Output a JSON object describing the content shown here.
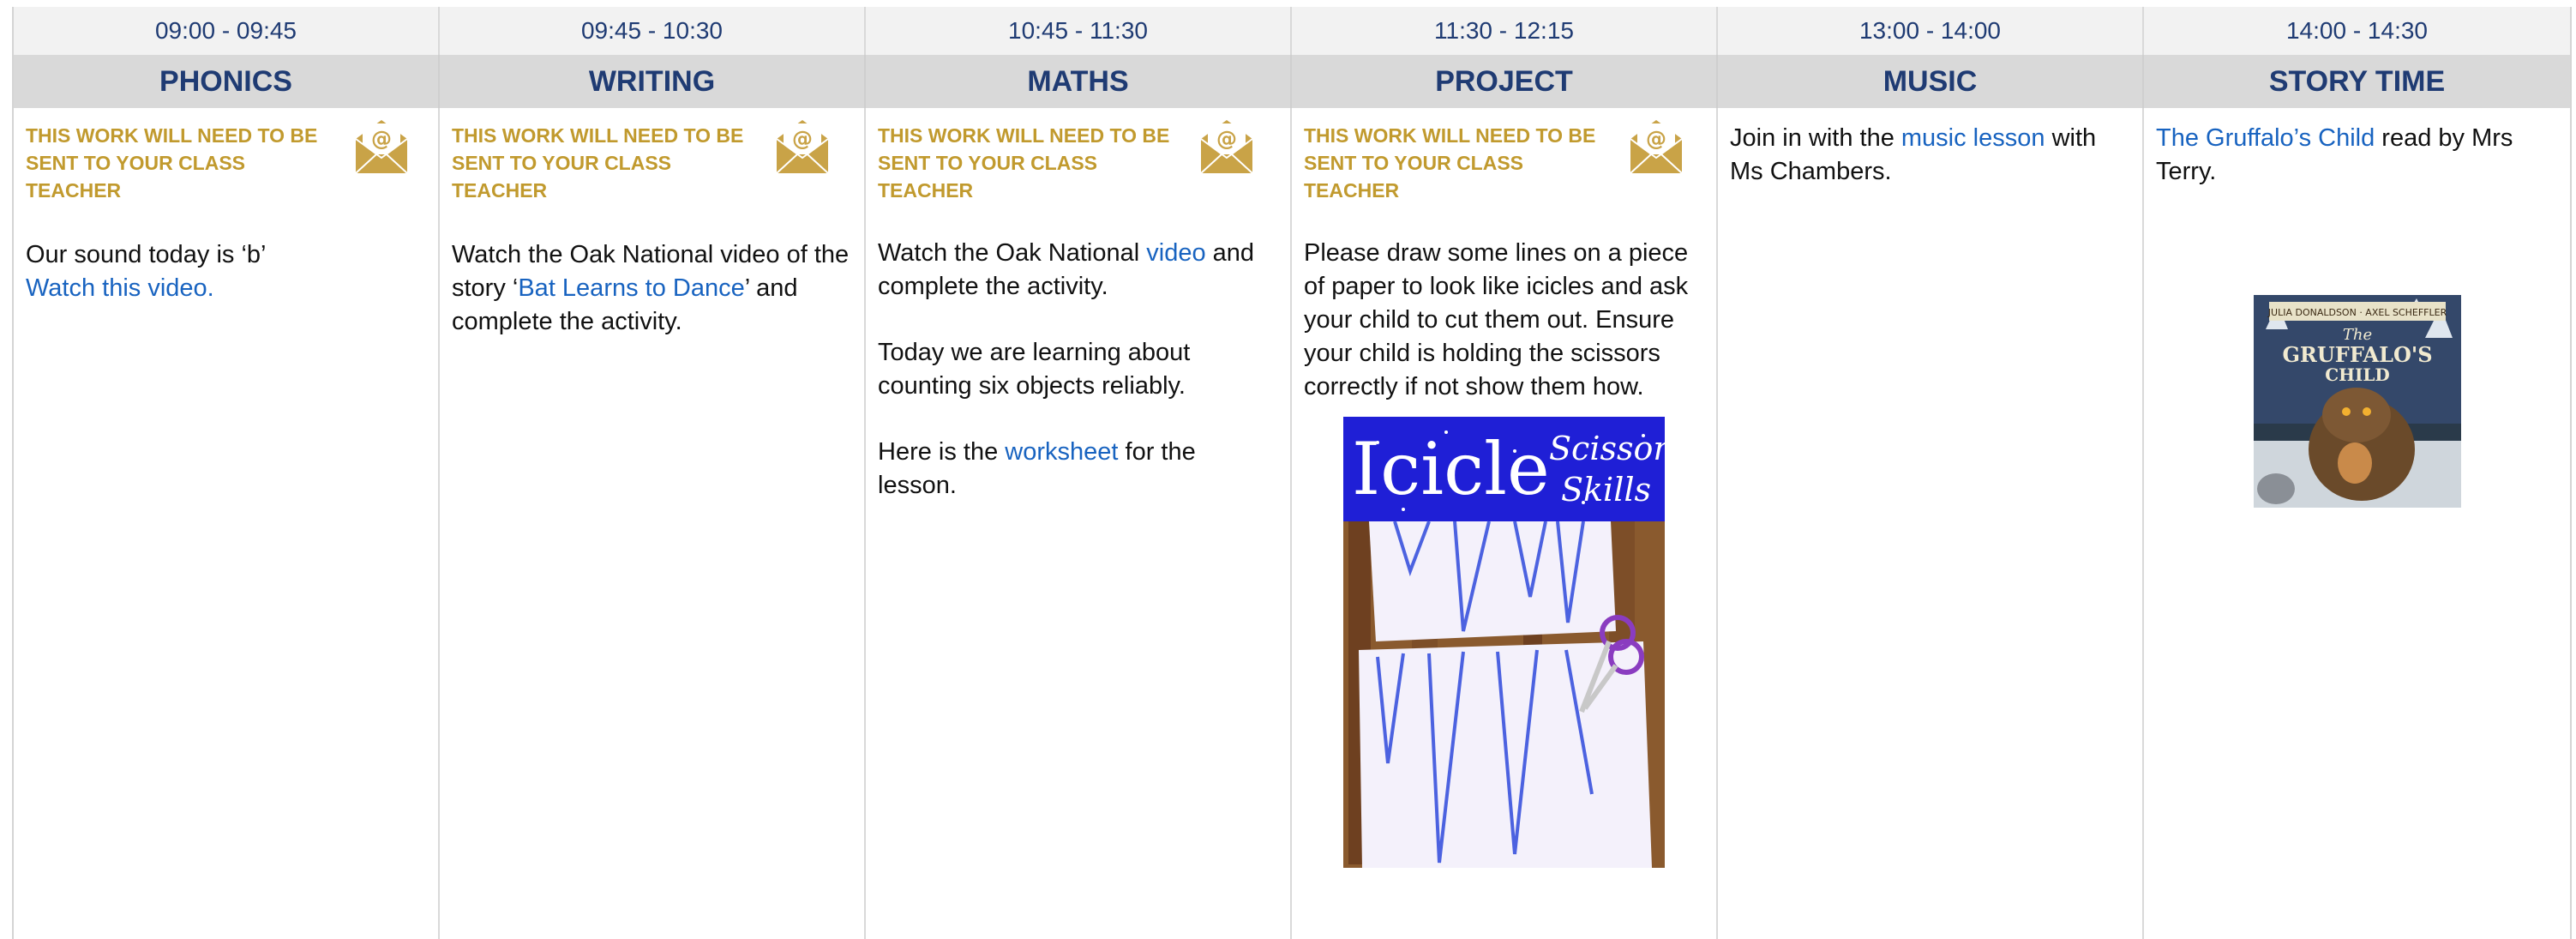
{
  "times": [
    "09:00 - 09:45",
    "09:45 - 10:30",
    "10:45 - 11:30",
    "11:30 - 12:15",
    "13:00 - 14:00",
    "14:00 - 14:30"
  ],
  "subjects": [
    "PHONICS",
    "WRITING",
    "MATHS",
    "PROJECT",
    "MUSIC",
    "STORY TIME"
  ],
  "notice": "THIS WORK WILL NEED TO BE SENT TO YOUR CLASS TEACHER",
  "colors": {
    "heading": "#1f3b73",
    "notice": "#c19a2e",
    "link": "#1863c0",
    "header_bg": "#d9d9d9",
    "time_bg": "#f2f2f2"
  },
  "icons": {
    "email": "email-envelope-icon"
  },
  "phonics": {
    "line1": "Our sound today is ‘b’",
    "link": "Watch this video."
  },
  "writing": {
    "pre": "Watch the Oak National video of the story ‘",
    "link": "Bat Learns to Dance",
    "post": "’ and complete the activity."
  },
  "maths": {
    "p1_pre": "Watch the Oak National ",
    "p1_link": "video",
    "p1_post": " and complete the activity.",
    "p2": "Today we are learning about counting six objects reliably.",
    "p3_pre": "Here is the ",
    "p3_link": "worksheet",
    "p3_post": " for the lesson."
  },
  "project": {
    "text": "Please draw some lines on a piece of paper to look like icicles and ask your child to cut them out. Ensure your child is holding the scissors correctly if not show them how.",
    "image_title": "Icicle",
    "image_subtitle_1": "Scissor",
    "image_subtitle_2": "Skills"
  },
  "music": {
    "pre": "Join in with the ",
    "link": "music lesson",
    "post": " with Ms Chambers."
  },
  "story": {
    "link": "The Gruffalo’s Child",
    "post": " read by Mrs Terry.",
    "book_authors": "JULIA DONALDSON · AXEL SCHEFFLER",
    "book_title_1": "The",
    "book_title_2": "GRUFFALO'S",
    "book_title_3": "CHILD"
  }
}
